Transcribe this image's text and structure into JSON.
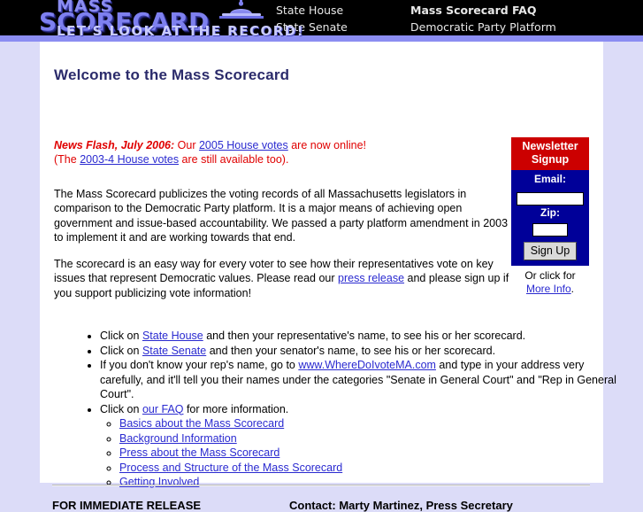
{
  "site": {
    "logo_line1": "MASS",
    "logo_line2": "SCORECARD",
    "tagline": "LET'S LOOK AT THE RECORD!",
    "dome_icon": "state-house-dome-icon"
  },
  "nav": {
    "column1": [
      {
        "label": "State House"
      },
      {
        "label": "State Senate"
      }
    ],
    "column2": [
      {
        "label": "Mass Scorecard FAQ"
      },
      {
        "label": "Democratic Party Platform"
      }
    ]
  },
  "main": {
    "heading": "Welcome to the Mass Scorecard",
    "newsflash": {
      "label": "News Flash, July 2006:",
      "text_before_link": " Our ",
      "link1": "2005 House votes",
      "text_after_link": " are now online!",
      "line2_before": "(The ",
      "link2": "2003-4 House votes",
      "line2_after": " are still available too)."
    },
    "paragraph1": "The Mass Scorecard publicizes the voting records of all Massachusetts legislators in comparison to the Democratic Party platform. It is a major means of achieving open government and issue-based accountability. We passed a party platform amendment in 2003 to implement it and are working towards that end.",
    "paragraph2_part1": "The scorecard is an easy way for every voter to see how their representatives vote on key issues that represent Democratic values. Please read our ",
    "paragraph2_link": "press release",
    "paragraph2_part2": " and please sign up if you support publicizing vote information!",
    "bullets": {
      "b1_pre": "Click on ",
      "b1_link": "State House",
      "b1_post": " and then your representative's name, to see his or her scorecard.",
      "b2_pre": "Click on ",
      "b2_link": "State Senate",
      "b2_post": " and then your senator's name, to see his or her scorecard.",
      "b3_pre": "If you don't know your rep's name, go to ",
      "b3_link": "www.WhereDoIvoteMA.com",
      "b3_post": " and type in your address very carefully, and it'll tell you their names under the categories \"Senate in General Court\" and \"Rep in General Court\".",
      "b4_pre": "Click on ",
      "b4_link": "our FAQ",
      "b4_post": " for more information."
    },
    "sublinks": [
      {
        "label": "Basics about the Mass Scorecard"
      },
      {
        "label": "Background Information"
      },
      {
        "label": "Press about the Mass Scorecard"
      },
      {
        "label": "Process and Structure of the Mass Scorecard"
      },
      {
        "label": "Getting Involved"
      }
    ]
  },
  "signup": {
    "title_line1": "Newsletter",
    "title_line2": "Signup",
    "email_label": "Email:",
    "email_value": "",
    "email_placeholder": "",
    "zip_label": "Zip:",
    "zip_value": "",
    "zip_placeholder": "",
    "button_label": "Sign Up",
    "more_text": "Or click for",
    "more_link": "More Info",
    "more_period": "."
  },
  "footer": {
    "release": "FOR IMMEDIATE RELEASE",
    "contact": "Contact: Marty Martinez, Press Secretary"
  },
  "colors": {
    "header_bg": "#000000",
    "band": "#8b8df2",
    "page_bg": "#dcdcf8",
    "content_bg": "#ffffff",
    "heading": "#2b2b6b",
    "newsflash": "#e00000",
    "link": "#2a2ad0",
    "signup_title_bg": "#cc0000",
    "signup_body_bg": "#000099"
  }
}
